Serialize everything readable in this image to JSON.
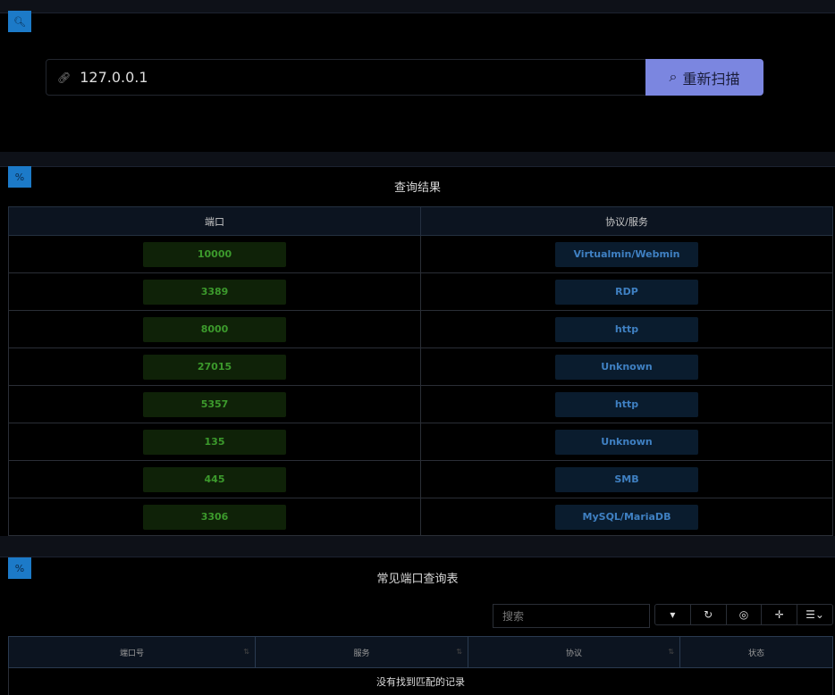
{
  "scan": {
    "ip_value": "127.0.0.1",
    "button_label": "重新扫描"
  },
  "results": {
    "title": "查询结果",
    "headers": [
      "端口",
      "协议/服务"
    ],
    "rows": [
      {
        "port": "10000",
        "service": "Virtualmin/Webmin"
      },
      {
        "port": "3389",
        "service": "RDP"
      },
      {
        "port": "8000",
        "service": "http"
      },
      {
        "port": "27015",
        "service": "Unknown"
      },
      {
        "port": "5357",
        "service": "http"
      },
      {
        "port": "135",
        "service": "Unknown"
      },
      {
        "port": "445",
        "service": "SMB"
      },
      {
        "port": "3306",
        "service": "MySQL/MariaDB"
      }
    ]
  },
  "reference": {
    "title": "常见端口查询表",
    "search_placeholder": "搜索",
    "headers": [
      "端口号",
      "服务",
      "协议",
      "状态"
    ],
    "empty_text": "没有找到匹配的记录"
  },
  "colors": {
    "accent": "#7b86e0",
    "panel_icon": "#1c7ac8",
    "port_text": "#3c9a2c",
    "service_text": "#3f80c2"
  }
}
